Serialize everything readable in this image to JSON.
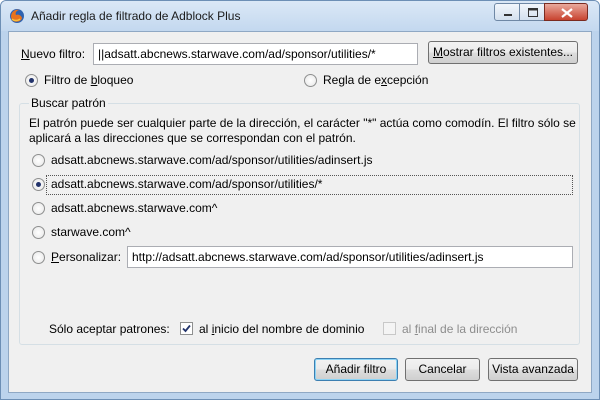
{
  "window": {
    "title": "Añadir regla de filtrado de Adblock Plus"
  },
  "filter": {
    "label_prefix": "N",
    "label_rest": "uevo filtro:",
    "value": "||adsatt.abcnews.starwave.com/ad/sponsor/utilities/*",
    "show_existing_pre": "M",
    "show_existing_rest": "ostrar filtros existentes..."
  },
  "type": {
    "blocking_pre": "Filtro de ",
    "blocking_key": "b",
    "blocking_post": "loqueo",
    "exception_pre": "Regla de e",
    "exception_key": "x",
    "exception_post": "cepción"
  },
  "pattern": {
    "group_title": "Buscar patrón",
    "description_line1": "El patrón puede ser cualquier parte de la dirección, el carácter \"*\" actúa como comodín. El filtro sólo se",
    "description_line2": "aplicará a las direcciones que se correspondan con el patrón.",
    "options": [
      {
        "label": "adsatt.abcnews.starwave.com/ad/sponsor/utilities/adinsert.js",
        "selected": false
      },
      {
        "label": "adsatt.abcnews.starwave.com/ad/sponsor/utilities/*",
        "selected": true
      },
      {
        "label": "adsatt.abcnews.starwave.com^",
        "selected": false
      },
      {
        "label": "starwave.com^",
        "selected": false
      }
    ],
    "custom_key": "P",
    "custom_rest": "ersonalizar:",
    "custom_value": "http://adsatt.abcnews.starwave.com/ad/sponsor/utilities/adinsert.js"
  },
  "accept": {
    "label": "Sólo aceptar patrones:",
    "start_pre": "al ",
    "start_key": "i",
    "start_post": "nicio del nombre de dominio",
    "start_checked": true,
    "end_pre": "al ",
    "end_key": "f",
    "end_post": "inal de la dirección",
    "end_checked": false
  },
  "buttons": {
    "add": "Añadir filtro",
    "cancel": "Cancelar",
    "advanced": "Vista avanzada"
  }
}
